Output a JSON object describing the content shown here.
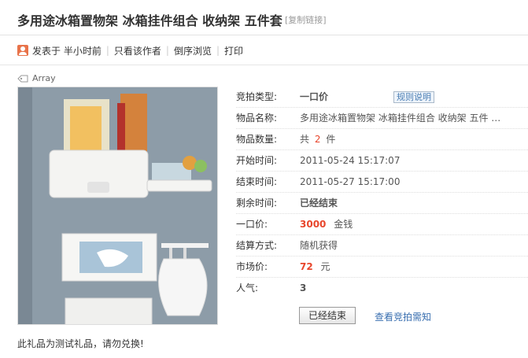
{
  "header": {
    "title": "多用途冰箱置物架 冰箱挂件组合 收纳架 五件套",
    "copy_link": "[复制链接]"
  },
  "meta": {
    "posted": "发表于 半小时前",
    "only_author": "只看该作者",
    "reverse_order": "倒序浏览",
    "print": "打印"
  },
  "tag": {
    "label": "Array"
  },
  "details": {
    "auction_type_label": "竞拍类型:",
    "auction_type_value": "一口价",
    "rules_button": "规则说明",
    "item_name_label": "物品名称:",
    "item_name_value": "多用途冰箱置物架 冰箱挂件组合 收纳架 五件 …",
    "quantity_label": "物品数量:",
    "quantity_prefix": "共",
    "quantity_value": "2",
    "quantity_unit": "件",
    "start_label": "开始时间:",
    "start_value": "2011-05-24 15:17:07",
    "end_label": "结束时间:",
    "end_value": "2011-05-27 15:17:00",
    "remaining_label": "剩余时间:",
    "remaining_value": "已经结束",
    "price_label": "一口价:",
    "price_value": "3000",
    "price_unit": "金钱",
    "settle_label": "结算方式:",
    "settle_value": "随机获得",
    "market_label": "市场价:",
    "market_value": "72",
    "market_unit": "元",
    "popularity_label": "人气:",
    "popularity_value": "3"
  },
  "actions": {
    "ended_button": "已经结束",
    "view_link": "查看竞拍需知"
  },
  "footer": {
    "note": "此礼品为测试礼品，请勿兑换!"
  },
  "colors": {
    "accent_red": "#e8462c",
    "link_blue": "#3a6fb0"
  }
}
